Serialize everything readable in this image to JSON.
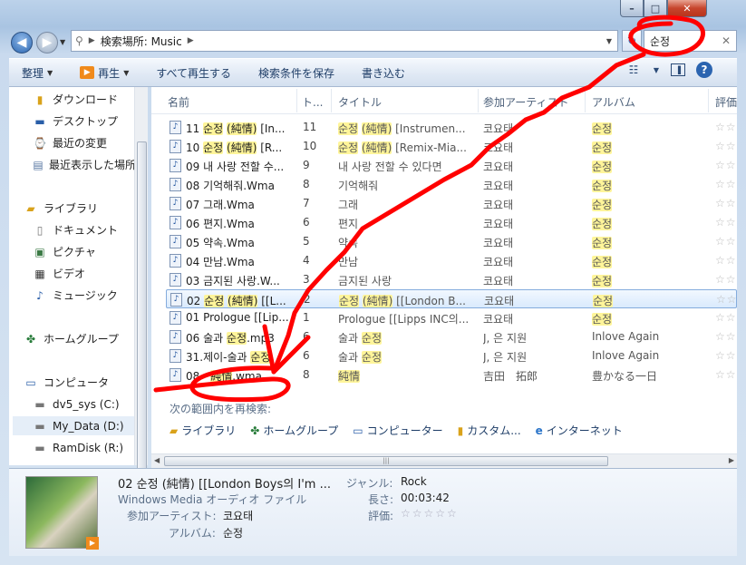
{
  "window": {
    "min": "–",
    "max": "□",
    "close": "✕"
  },
  "address": {
    "path_label": "検索場所: Music",
    "search_value": "순정"
  },
  "toolbar": {
    "organize": "整理",
    "play": "再生",
    "play_all": "すべて再生する",
    "save_search": "検索条件を保存",
    "burn": "書き込む"
  },
  "nav": {
    "favorites": [
      {
        "label": "ダウンロード"
      },
      {
        "label": "デスクトップ"
      },
      {
        "label": "最近の変更"
      },
      {
        "label": "最近表示した場所"
      }
    ],
    "libraries": {
      "label": "ライブラリ",
      "items": [
        {
          "label": "ドキュメント"
        },
        {
          "label": "ピクチャ"
        },
        {
          "label": "ビデオ"
        },
        {
          "label": "ミュージック"
        }
      ]
    },
    "homegroup": "ホームグループ",
    "computer": {
      "label": "コンピュータ",
      "items": [
        {
          "label": "dv5_sys (C:)"
        },
        {
          "label": "My_Data (D:)"
        },
        {
          "label": "RamDisk (R:)"
        }
      ]
    }
  },
  "columns": {
    "name": "名前",
    "track": "ト...",
    "title": "タイトル",
    "artist": "参加アーティスト",
    "album": "アルバム",
    "rating": "評価"
  },
  "rows": [
    {
      "name_pre": "11 ",
      "name_hl": "순정",
      "name_mid": " ",
      "name_hl2": "(純情)",
      "name_post": " [In...",
      "track": "11",
      "title_hl": "순정",
      "title_mid": " ",
      "title_hl2": "(純情)",
      "title_post": " [Instrumen...",
      "artist": "코요태",
      "album_hl": "순정",
      "album": "",
      "rating": "☆☆"
    },
    {
      "name_pre": "10 ",
      "name_hl": "순정",
      "name_mid": " ",
      "name_hl2": "(純情)",
      "name_post": " [R...",
      "track": "10",
      "title_hl": "순정",
      "title_mid": " ",
      "title_hl2": "(純情)",
      "title_post": " [Remix-Mia...",
      "artist": "코요태",
      "album_hl": "순정",
      "album": "",
      "rating": "☆☆"
    },
    {
      "name_pre": "09 내 사랑 전할 수...",
      "track": "9",
      "title_post": "내 사랑 전할 수 있다면",
      "artist": "코요태",
      "album_hl": "순정",
      "album": "",
      "rating": "☆☆"
    },
    {
      "name_pre": "08 기억해줘.Wma",
      "track": "8",
      "title_post": "기억해줘",
      "artist": "코요태",
      "album_hl": "순정",
      "album": "",
      "rating": "☆☆"
    },
    {
      "name_pre": "07 그래.Wma",
      "track": "7",
      "title_post": "그래",
      "artist": "코요태",
      "album_hl": "순정",
      "album": "",
      "rating": "☆☆"
    },
    {
      "name_pre": "06 편지.Wma",
      "track": "6",
      "title_post": "편지",
      "artist": "코요태",
      "album_hl": "순정",
      "album": "",
      "rating": "☆☆"
    },
    {
      "name_pre": "05 약속.Wma",
      "track": "5",
      "title_post": "약속",
      "artist": "코요태",
      "album_hl": "순정",
      "album": "",
      "rating": "☆☆"
    },
    {
      "name_pre": "04 만남.Wma",
      "track": "4",
      "title_post": "만남",
      "artist": "코요태",
      "album_hl": "순정",
      "album": "",
      "rating": "☆☆"
    },
    {
      "name_pre": "03 금지된 사랑.W...",
      "track": "3",
      "title_post": "금지된 사랑",
      "artist": "코요태",
      "album_hl": "순정",
      "album": "",
      "rating": "☆☆"
    },
    {
      "name_pre": "02 ",
      "name_hl": "순정",
      "name_mid": " ",
      "name_hl2": "(純情)",
      "name_post": " [[L...",
      "track": "2",
      "title_hl": "순정",
      "title_mid": " ",
      "title_hl2": "(純情)",
      "title_post": " [[London B...",
      "artist": "코요태",
      "album_hl": "순정",
      "album": "",
      "rating": "☆☆",
      "selected": true
    },
    {
      "name_pre": "01 Prologue [[Lip...",
      "track": "1",
      "title_post": "Prologue [[Lipps INC의...",
      "artist": "코요태",
      "album_hl": "순정",
      "album": "",
      "rating": "☆☆"
    },
    {
      "name_pre": "06 술과 ",
      "name_hl": "순정",
      "name_post": ".mp3",
      "track": "6",
      "title_post": "술과 ",
      "title_hl": "순정",
      "title_order": "post_first",
      "artist": "J, 은 지원",
      "album": "Inlove Again",
      "rating": "☆☆"
    },
    {
      "name_pre": "31.제이-술과 ",
      "name_hl": "순정",
      "name_post": "",
      "track": "6",
      "title_post": "술과 ",
      "title_hl": "순정",
      "title_order": "post_first",
      "artist": "J, 은 지원",
      "album": "Inlove Again",
      "rating": "☆☆"
    },
    {
      "name_pre": "08 - ",
      "name_hl": "純情",
      "name_post": ".wma",
      "track": "8",
      "title_hl": "純情",
      "title_post": "",
      "artist": "吉田　拓郎",
      "album": "豊かなる一日",
      "rating": "☆☆"
    }
  ],
  "search_again": {
    "label": "次の範囲内を再検索:",
    "items": [
      {
        "label": "ライブラリ"
      },
      {
        "label": "ホームグループ"
      },
      {
        "label": "コンピューター"
      },
      {
        "label": "カスタム..."
      },
      {
        "label": "インターネット"
      }
    ]
  },
  "details": {
    "title": "02 순정 (純情) [[London Boys의 I'm ...",
    "type": "Windows Media オーディオ ファイル",
    "artist_label": "参加アーティスト:",
    "artist": "코요태",
    "album_label": "アルバム:",
    "album": "순정",
    "genre_label": "ジャンル:",
    "genre": "Rock",
    "length_label": "長さ:",
    "length": "00:03:42",
    "rating_label": "評価:",
    "rating": "☆☆☆☆☆"
  },
  "colors": {
    "highlight": "#fff59a",
    "annotation": "#ff0000",
    "selection": "#d9eafd"
  }
}
